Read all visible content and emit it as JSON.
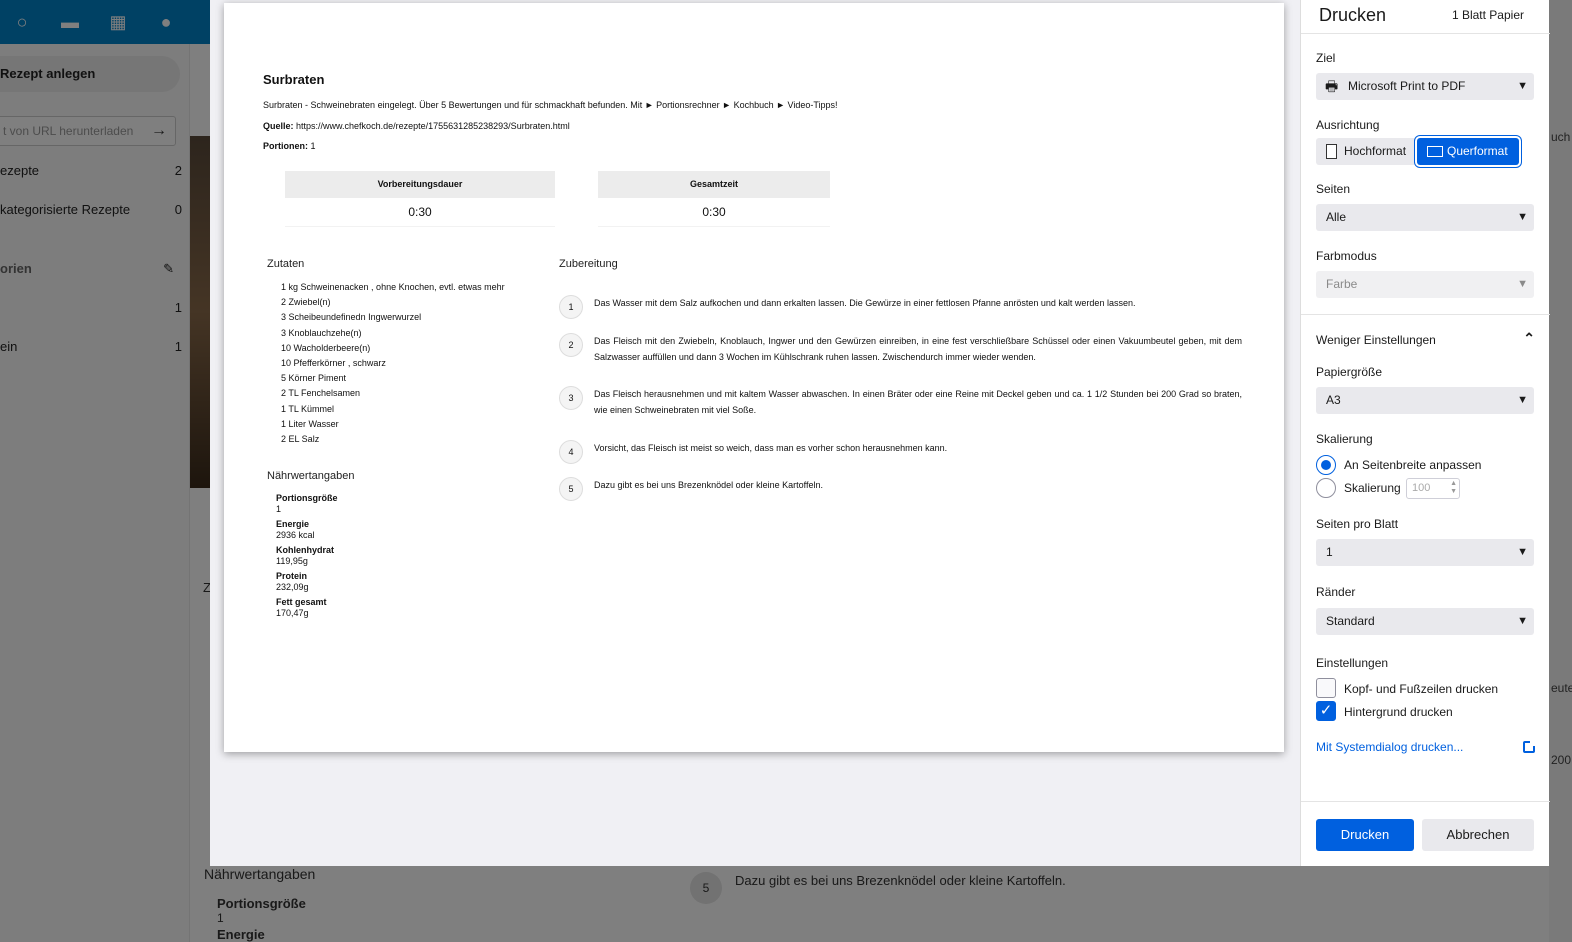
{
  "background_app": {
    "new_recipe_label": "Rezept anlegen",
    "url_placeholder": "t von URL herunterladen",
    "nav": [
      {
        "label": "ezepte",
        "count": "2"
      },
      {
        "label": "kategorisierte Rezepte",
        "count": "0"
      },
      {
        "label": "orien",
        "count": ""
      },
      {
        "label": "",
        "count": "1"
      },
      {
        "label": "ein",
        "count": "1"
      }
    ],
    "bottom_nutrition_heading": "Nährwertangaben",
    "bottom_portion_label": "Portionsgröße",
    "bottom_portion_value": "1",
    "bottom_energy_label": "Energie",
    "bottom_step_number": "5",
    "bottom_step_text": "Dazu gibt es bei uns Brezenknödel oder kleine Kartoffeln.",
    "right_edge_texts": [
      "uch",
      "eute",
      "200"
    ],
    "left_fragment": "Z"
  },
  "preview": {
    "title": "Surbraten",
    "description": "Surbraten - Schweinebraten eingelegt. Über 5 Bewertungen und für schmackhaft befunden. Mit ► Portionsrechner ► Kochbuch ► Video-Tipps!",
    "source_label": "Quelle:",
    "source_url": "https://www.chefkoch.de/rezepte/1755631285238293/Surbraten.html",
    "portions_label": "Portionen:",
    "portions_value": "1",
    "prep_label": "Vorbereitungsdauer",
    "prep_value": "0:30",
    "total_label": "Gesamtzeit",
    "total_value": "0:30",
    "ingredients_heading": "Zutaten",
    "ingredients": [
      "1 kg Schweinenacken , ohne Knochen, evtl. etwas mehr",
      "2 Zwiebel(n)",
      "3 Scheibeundefinedn Ingwerwurzel",
      "3 Knoblauchzehe(n)",
      "10 Wacholderbeere(n)",
      "10 Pfefferkörner , schwarz",
      "5 Körner Piment",
      "2 TL Fenchelsamen",
      "1 TL Kümmel",
      "1 Liter Wasser",
      "2 EL Salz"
    ],
    "nutrition_heading": "Nährwertangaben",
    "nutrition": [
      {
        "label": "Portionsgröße",
        "value": "1"
      },
      {
        "label": "Energie",
        "value": "2936 kcal"
      },
      {
        "label": "Kohlenhydrat",
        "value": "119,95g"
      },
      {
        "label": "Protein",
        "value": "232,09g"
      },
      {
        "label": "Fett gesamt",
        "value": "170,47g"
      }
    ],
    "instructions_heading": "Zubereitung",
    "steps": [
      {
        "n": "1",
        "text": "Das Wasser mit dem Salz aufkochen und dann erkalten lassen. Die Gewürze in einer fettlosen Pfanne anrösten und kalt werden lassen."
      },
      {
        "n": "2",
        "text": "Das Fleisch mit den Zwiebeln, Knoblauch, Ingwer und den Gewürzen einreiben, in eine fest verschließbare Schüssel oder einen Vakuumbeutel geben, mit dem Salzwasser auffüllen und dann 3 Wochen im Kühlschrank ruhen lassen. Zwischendurch immer wieder wenden."
      },
      {
        "n": "3",
        "text": "Das Fleisch herausnehmen und mit kaltem Wasser abwaschen. In einen Bräter oder eine Reine mit Deckel geben und ca. 1 1/2 Stunden bei 200 Grad so braten, wie einen Schweinebraten mit viel Soße."
      },
      {
        "n": "4",
        "text": "Vorsicht, das Fleisch ist meist so weich, dass man es vorher schon herausnehmen kann."
      },
      {
        "n": "5",
        "text": "Dazu gibt es bei uns Brezenknödel oder kleine Kartoffeln."
      }
    ]
  },
  "panel": {
    "title": "Drucken",
    "sheet_count": "1 Blatt Papier",
    "destination_label": "Ziel",
    "destination_value": "Microsoft Print to PDF",
    "orientation_label": "Ausrichtung",
    "portrait_label": "Hochformat",
    "landscape_label": "Querformat",
    "pages_label": "Seiten",
    "pages_value": "Alle",
    "color_label": "Farbmodus",
    "color_value": "Farbe",
    "fewer_settings_label": "Weniger Einstellungen",
    "paper_size_label": "Papiergröße",
    "paper_size_value": "A3",
    "scaling_label": "Skalierung",
    "fit_width_label": "An Seitenbreite anpassen",
    "scale_option_label": "Skalierung",
    "scale_value": "100",
    "pages_per_sheet_label": "Seiten pro Blatt",
    "pages_per_sheet_value": "1",
    "margins_label": "Ränder",
    "margins_value": "Standard",
    "settings_label": "Einstellungen",
    "headers_footers_label": "Kopf- und Fußzeilen drucken",
    "background_label": "Hintergrund drucken",
    "system_dialog_label": "Mit Systemdialog drucken...",
    "print_button": "Drucken",
    "cancel_button": "Abbrechen"
  },
  "colors": {
    "accent": "#0060df",
    "topbar": "#0082c9"
  }
}
